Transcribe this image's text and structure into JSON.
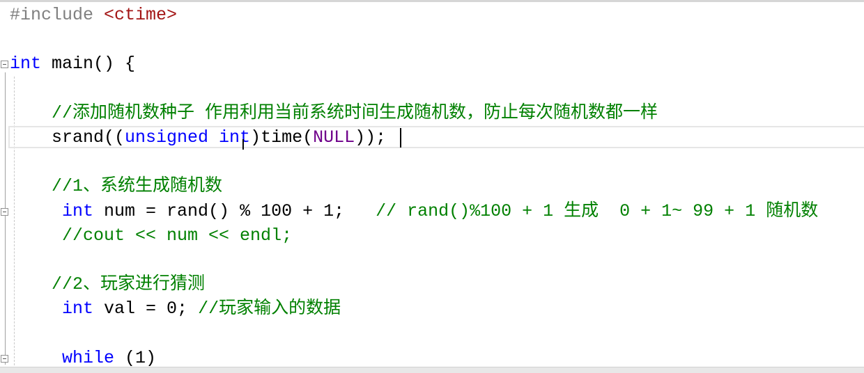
{
  "editor": {
    "language": "C++",
    "colors": {
      "preprocessor": "#808080",
      "header": "#a31515",
      "keyword": "#0000ff",
      "comment": "#008000",
      "macro": "#6f008a",
      "text": "#000000"
    },
    "current_line_index": 5,
    "lines": [
      [
        {
          "t": "pre",
          "v": "#include "
        },
        {
          "t": "str",
          "v": "<ctime>"
        }
      ],
      [],
      [
        {
          "t": "kw",
          "v": "int"
        },
        {
          "t": "txt",
          "v": " main() {"
        }
      ],
      [],
      [
        {
          "t": "txt",
          "v": "    "
        },
        {
          "t": "com",
          "v": "//添加随机数种子 作用利用当前系统时间生成随机数，防止每次随机数都一样"
        }
      ],
      [
        {
          "t": "txt",
          "v": "    srand(("
        },
        {
          "t": "kw",
          "v": "unsigned int"
        },
        {
          "t": "txt",
          "v": ")time("
        },
        {
          "t": "mac",
          "v": "NULL"
        },
        {
          "t": "txt",
          "v": "));"
        }
      ],
      [],
      [
        {
          "t": "txt",
          "v": "    "
        },
        {
          "t": "com",
          "v": "//1、系统生成随机数"
        }
      ],
      [
        {
          "t": "txt",
          "v": "     "
        },
        {
          "t": "kw",
          "v": "int"
        },
        {
          "t": "txt",
          "v": " num = rand() % 100 + 1;   "
        },
        {
          "t": "com",
          "v": "// rand()%100 + 1 生成  0 + 1~ 99 + 1 随机数"
        }
      ],
      [
        {
          "t": "txt",
          "v": "     "
        },
        {
          "t": "com",
          "v": "//cout << num << endl;"
        }
      ],
      [],
      [
        {
          "t": "txt",
          "v": "    "
        },
        {
          "t": "com",
          "v": "//2、玩家进行猜测"
        }
      ],
      [
        {
          "t": "txt",
          "v": "     "
        },
        {
          "t": "kw",
          "v": "int"
        },
        {
          "t": "txt",
          "v": " val = 0; "
        },
        {
          "t": "com",
          "v": "//玩家输入的数据"
        }
      ],
      [],
      [
        {
          "t": "txt",
          "v": "     "
        },
        {
          "t": "kw",
          "v": "while"
        },
        {
          "t": "txt",
          "v": " (1)"
        }
      ]
    ],
    "fold_markers_lines": [
      2,
      8,
      14
    ]
  }
}
